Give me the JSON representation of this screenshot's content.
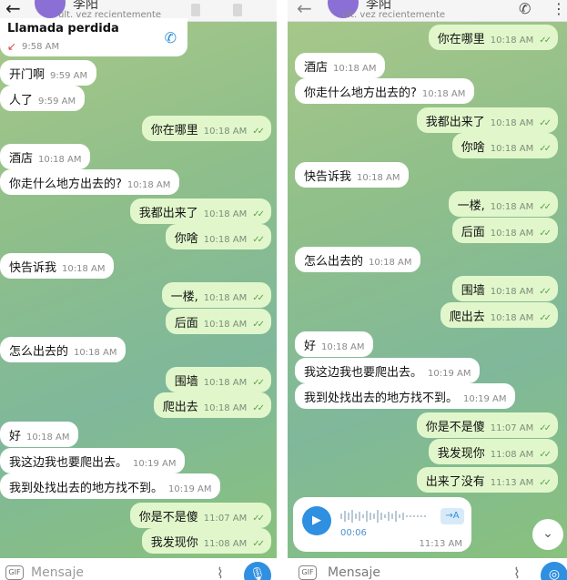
{
  "left": {
    "header": {
      "back": "←",
      "name": "李阳",
      "status": "últ. vez recientemente"
    },
    "call": {
      "title": "Llamada perdida",
      "time": "9:58 AM"
    },
    "messages": [
      {
        "text": "开门啊",
        "time": "9:59 AM",
        "dir": "in"
      },
      {
        "text": "人了",
        "time": "9:59 AM",
        "dir": "in"
      },
      {
        "text": "你在哪里",
        "time": "10:18 AM",
        "dir": "out"
      },
      {
        "text": "酒店",
        "time": "10:18 AM",
        "dir": "in"
      },
      {
        "text": "你走什么地方出去的?",
        "time": "10:18 AM",
        "dir": "in"
      },
      {
        "text": "我都出来了",
        "time": "10:18 AM",
        "dir": "out"
      },
      {
        "text": "你啥",
        "time": "10:18 AM",
        "dir": "out"
      },
      {
        "text": "快告诉我",
        "time": "10:18 AM",
        "dir": "in"
      },
      {
        "text": "一楼,",
        "time": "10:18 AM",
        "dir": "out"
      },
      {
        "text": "后面",
        "time": "10:18 AM",
        "dir": "out"
      },
      {
        "text": "怎么出去的",
        "time": "10:18 AM",
        "dir": "in"
      },
      {
        "text": "围墙",
        "time": "10:18 AM",
        "dir": "out"
      },
      {
        "text": "爬出去",
        "time": "10:18 AM",
        "dir": "out"
      },
      {
        "text": "好",
        "time": "10:18 AM",
        "dir": "in"
      },
      {
        "text": "我这边我也要爬出去。",
        "time": "10:19 AM",
        "dir": "in"
      },
      {
        "text": "我到处找出去的地方找不到。",
        "time": "10:19 AM",
        "dir": "in"
      },
      {
        "text": "你是不是傻",
        "time": "11:07 AM",
        "dir": "out"
      },
      {
        "text": "我发现你",
        "time": "11:08 AM",
        "dir": "out"
      }
    ],
    "input": {
      "gif": "GIF",
      "placeholder": "Mensaje"
    }
  },
  "right": {
    "header": {
      "name": "李阳",
      "status": "últ. vez recientemente"
    },
    "messages": [
      {
        "text": "你在哪里",
        "time": "10:18 AM",
        "dir": "out"
      },
      {
        "text": "酒店",
        "time": "10:18 AM",
        "dir": "in"
      },
      {
        "text": "你走什么地方出去的?",
        "time": "10:18 AM",
        "dir": "in"
      },
      {
        "text": "我都出来了",
        "time": "10:18 AM",
        "dir": "out"
      },
      {
        "text": "你啥",
        "time": "10:18 AM",
        "dir": "out"
      },
      {
        "text": "快告诉我",
        "time": "10:18 AM",
        "dir": "in"
      },
      {
        "text": "一楼,",
        "time": "10:18 AM",
        "dir": "out"
      },
      {
        "text": "后面",
        "time": "10:18 AM",
        "dir": "out"
      },
      {
        "text": "怎么出去的",
        "time": "10:18 AM",
        "dir": "in"
      },
      {
        "text": "围墙",
        "time": "10:18 AM",
        "dir": "out"
      },
      {
        "text": "爬出去",
        "time": "10:18 AM",
        "dir": "out"
      },
      {
        "text": "好",
        "time": "10:18 AM",
        "dir": "in"
      },
      {
        "text": "我这边我也要爬出去。",
        "time": "10:19 AM",
        "dir": "in"
      },
      {
        "text": "我到处找出去的地方找不到。",
        "time": "10:19 AM",
        "dir": "in"
      },
      {
        "text": "你是不是傻",
        "time": "11:07 AM",
        "dir": "out"
      },
      {
        "text": "我发现你",
        "time": "11:08 AM",
        "dir": "out"
      },
      {
        "text": "出来了没有",
        "time": "11:13 AM",
        "dir": "out"
      }
    ],
    "voice": {
      "duration": "00:06",
      "transcribe": "→A",
      "time": "11:13 AM"
    },
    "input": {
      "gif": "GIF",
      "placeholder": "Mensaje"
    }
  },
  "colors": {
    "outgoing": "#e1f7cb",
    "incoming": "#ffffff",
    "accent": "#2f8fe0",
    "checks": "#5da34f"
  }
}
